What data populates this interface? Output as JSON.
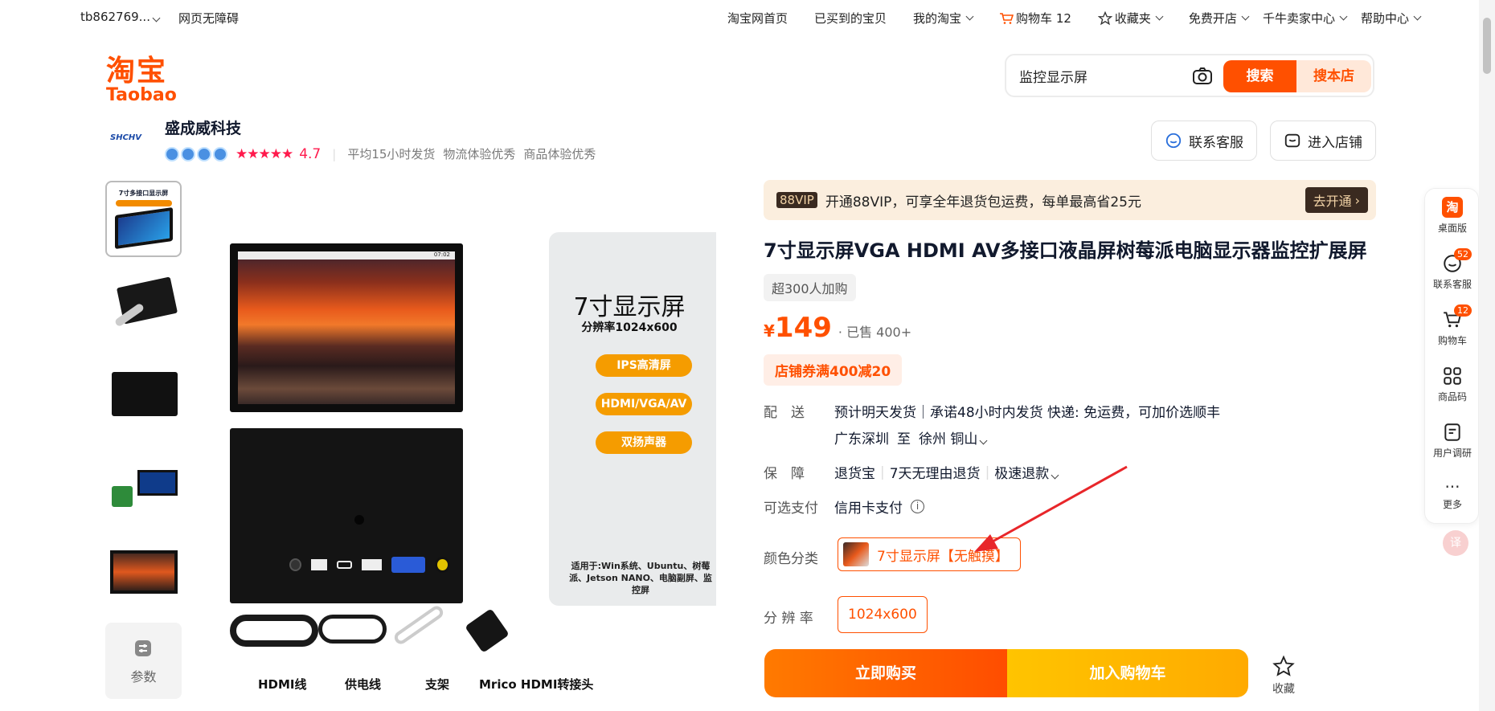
{
  "topbar": {
    "user": "tb862769...",
    "accessibility": "网页无障碍",
    "links": [
      "淘宝网首页",
      "已买到的宝贝",
      "我的淘宝",
      "购物车 12",
      "收藏夹",
      "免费开店",
      "千牛卖家中心",
      "帮助中心"
    ]
  },
  "logo": {
    "cn": "淘宝",
    "en": "Taobao"
  },
  "search": {
    "value": "监控显示屏",
    "search_label": "搜索",
    "shop_search_label": "搜本店"
  },
  "shop": {
    "logo_text": "SHCHV",
    "name": "盛成威科技",
    "rating": "4.7",
    "meta": [
      "平均15小时发货",
      "物流体验优秀",
      "商品体验优秀"
    ],
    "contact_label": "联系客服",
    "enter_label": "进入店铺"
  },
  "gallery": {
    "thumb1_title": "7寸多接口显示屏",
    "param_label": "参数",
    "main": {
      "headline": "7寸显示屏",
      "resolution": "分辨率1024x600",
      "pills": [
        "IPS高清屏",
        "HDMI/VGA/AV",
        "双扬声器"
      ],
      "usage": "适用于:Win系统、Ubuntu、树莓派、Jetson NANO、电脑副屏、监控屏",
      "screen_time": "07:02",
      "accessories": [
        "HDMI线",
        "供电线",
        "支架",
        "Mrico HDMI转接头"
      ]
    }
  },
  "vip": {
    "badge": "88VIP",
    "text": "开通88VIP，可享全年退货包运费，每单最高省25元",
    "action": "去开通"
  },
  "product": {
    "title": "7寸显示屏VGA HDMI AV多接口液晶屏树莓派电脑显示器监控扩展屏",
    "cart_tag": "超300人加购",
    "currency": "¥",
    "price": "149",
    "sold": "· 已售 400+",
    "coupon": "店铺券满400减20",
    "delivery_label": "配　送",
    "delivery_text": "预计明天发货｜承诺48小时内发货  快递: 免运费，可加价选顺丰",
    "from": "广东深圳",
    "to_word": "至",
    "to": "徐州 铜山",
    "guarantee_label": "保　障",
    "guarantees": [
      "退货宝",
      "7天无理由退货",
      "极速退款"
    ],
    "pay_label": "可选支付",
    "pay_value": "信用卡支付",
    "color_label": "颜色分类",
    "color_value": "7寸显示屏【无触摸】",
    "res_label": "分 辨 率",
    "res_value": "1024x600",
    "buy_label": "立即购买",
    "cart_label": "加入购物车",
    "fav_label": "收藏"
  },
  "sidebar": {
    "items": [
      {
        "label": "桌面版",
        "icon": "taobao-icon"
      },
      {
        "label": "联系客服",
        "badge": "52",
        "icon": "service-icon"
      },
      {
        "label": "购物车",
        "badge": "12",
        "icon": "cart-icon"
      },
      {
        "label": "商品码",
        "icon": "qr-icon"
      },
      {
        "label": "用户调研",
        "icon": "survey-icon"
      },
      {
        "label": "更多",
        "icon": "more-icon"
      }
    ]
  },
  "colors": {
    "accent": "#ff5000",
    "orange_pill": "#f59c00",
    "yellow": "#ffc400"
  }
}
